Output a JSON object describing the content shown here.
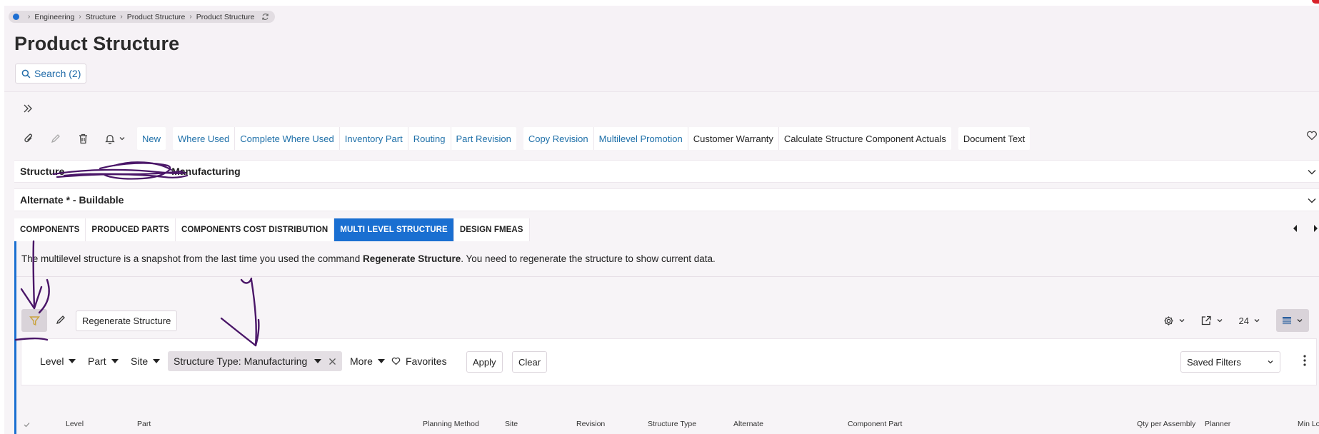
{
  "breadcrumb": {
    "items": [
      "Engineering",
      "Structure",
      "Product Structure",
      "Product Structure"
    ]
  },
  "page": {
    "title": "Product Structure",
    "search_label": "Search (2)"
  },
  "toolbar": {
    "group1": [
      "New"
    ],
    "group2": [
      "Where Used",
      "Complete Where Used",
      "Inventory Part",
      "Routing",
      "Part Revision"
    ],
    "group3": [
      "Copy Revision",
      "Multilevel Promotion",
      "Customer Warranty",
      "Calculate Structure Component Actuals"
    ],
    "group4": [
      "Document Text"
    ]
  },
  "header_bars": {
    "structure": "Structure",
    "structure_value": "Manufacturing",
    "alternate": "Alternate * - Buildable"
  },
  "tabs": [
    {
      "label": "COMPONENTS",
      "active": false
    },
    {
      "label": "PRODUCED PARTS",
      "active": false
    },
    {
      "label": "COMPONENTS COST DISTRIBUTION",
      "active": false
    },
    {
      "label": "MULTI LEVEL STRUCTURE",
      "active": true
    },
    {
      "label": "DESIGN FMEAS",
      "active": false
    }
  ],
  "info": {
    "prefix": "The multilevel structure is a snapshot from the last time you used the command ",
    "command": "Regenerate Structure",
    "suffix": ". You need to regenerate the structure to show current data."
  },
  "list_toolbar": {
    "regenerate_label": "Regenerate Structure",
    "page_size": "24"
  },
  "filters": {
    "level": "Level",
    "part": "Part",
    "site": "Site",
    "chip": "Structure Type: Manufacturing",
    "more": "More",
    "favorites": "Favorites",
    "apply": "Apply",
    "clear": "Clear",
    "saved_filters": "Saved Filters"
  },
  "table": {
    "columns": [
      "Level",
      "Part",
      "Planning Method",
      "Site",
      "Revision",
      "Structure Type",
      "Alternate",
      "Component Part",
      "Qty per Assembly",
      "Planner",
      "Min Lo"
    ]
  },
  "colors": {
    "accent": "#1a6fd1",
    "link": "#1d6fa8",
    "annotation": "#5a1a78"
  }
}
